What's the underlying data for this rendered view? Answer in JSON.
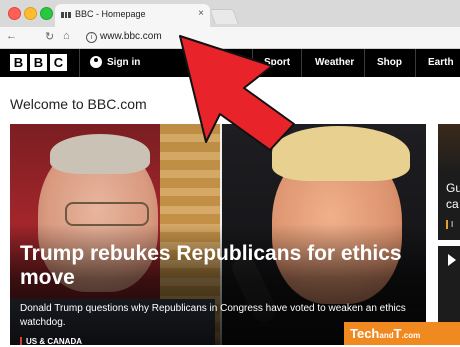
{
  "browser": {
    "tab_title": "BBC - Homepage",
    "tab_close": "×",
    "url": "www.bbc.com",
    "icons": {
      "back": "arrow-left-icon",
      "reload": "reload-icon",
      "home": "home-icon",
      "info": "info-icon"
    }
  },
  "header": {
    "logo_letters": [
      "B",
      "B",
      "C"
    ],
    "signin_label": "Sign in",
    "nav": [
      "Sport",
      "Weather",
      "Shop",
      "Earth"
    ]
  },
  "welcome": "Welcome to BBC.com",
  "hero": {
    "headline": "Trump rebukes Republicans for ethics move",
    "summary": "Donald Trump questions why Republicans in Congress have voted to weaken an ethics watchdog.",
    "tag": "US & CANADA"
  },
  "side": {
    "title": "Gu ca",
    "tag": "I"
  },
  "watermark": {
    "text_main": "Tech",
    "text_small": "and",
    "text_t": "T",
    "text_dot": ".com"
  },
  "colors": {
    "bbc_bar": "#000000",
    "arrow": "#e8232a",
    "watermark": "#f08a20"
  }
}
